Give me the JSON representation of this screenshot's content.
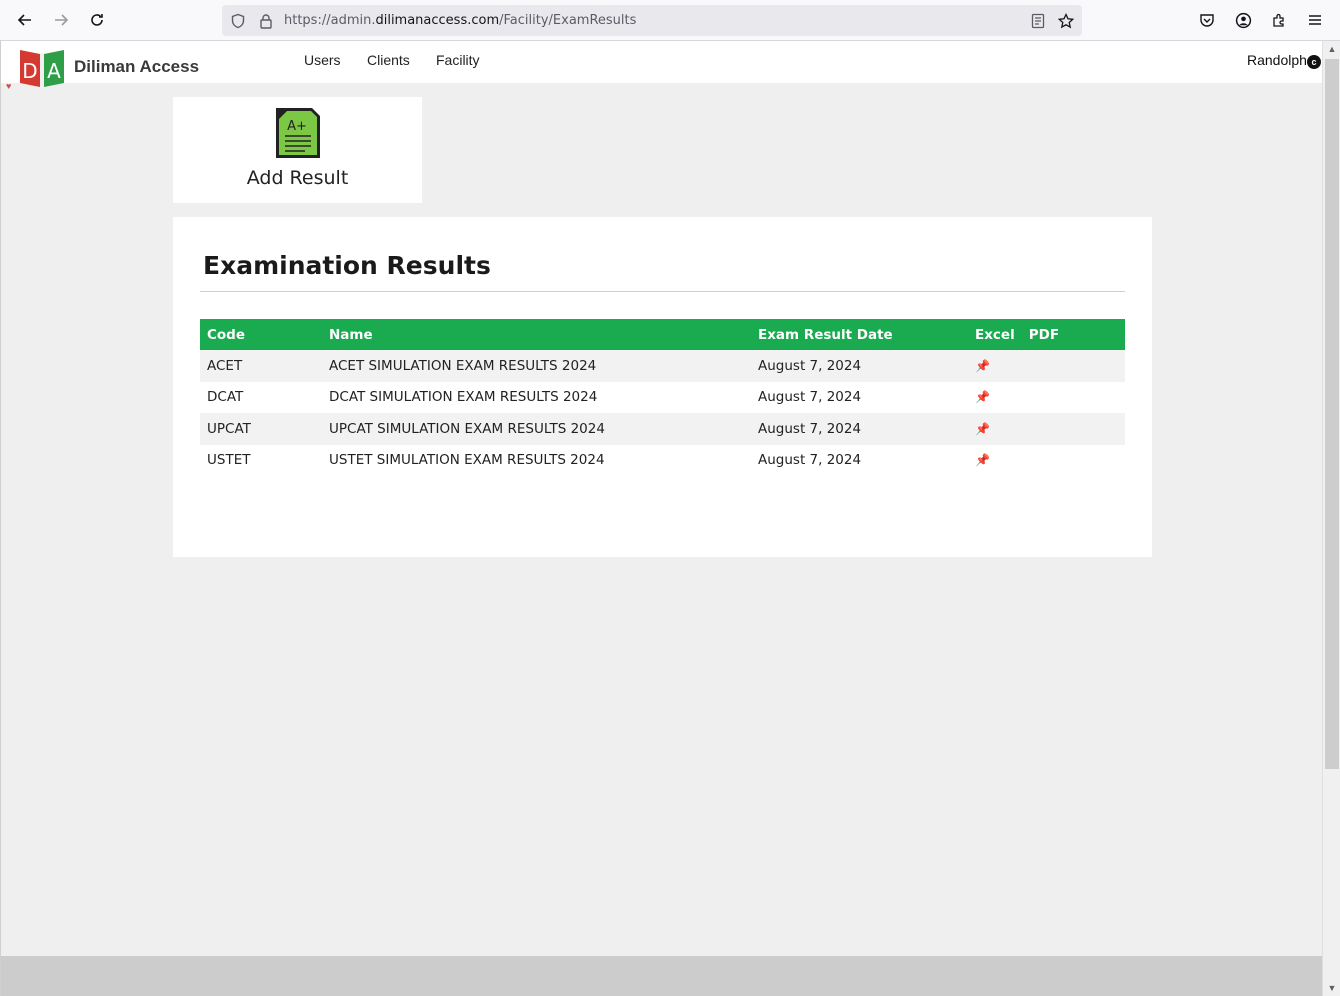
{
  "browser": {
    "url_prefix": "https://admin.",
    "url_domain": "dilimanaccess.com",
    "url_path": "/Facility/ExamResults"
  },
  "header": {
    "brand": "Diliman Access",
    "logo_letters": "DA",
    "nav": [
      "Users",
      "Clients",
      "Facility"
    ],
    "user": "Randolph",
    "user_icon_letter": "c"
  },
  "add_result": {
    "label": "Add Result",
    "icon_text": "A+"
  },
  "panel": {
    "title": "Examination Results",
    "columns": [
      "Code",
      "Name",
      "Exam Result Date",
      "Excel",
      "PDF"
    ],
    "rows": [
      {
        "code": "ACET",
        "name": "ACET SIMULATION EXAM RESULTS 2024",
        "date": "August 7, 2024"
      },
      {
        "code": "DCAT",
        "name": "DCAT SIMULATION EXAM RESULTS 2024",
        "date": "August 7, 2024"
      },
      {
        "code": "UPCAT",
        "name": "UPCAT SIMULATION EXAM RESULTS 2024",
        "date": "August 7, 2024"
      },
      {
        "code": "USTET",
        "name": "USTET SIMULATION EXAM RESULTS 2024",
        "date": "August 7, 2024"
      }
    ]
  },
  "colors": {
    "accent": "#1aaa50",
    "logo_red": "#d43a32",
    "logo_green": "#2e9e47",
    "footer_link": "#d9652a"
  }
}
